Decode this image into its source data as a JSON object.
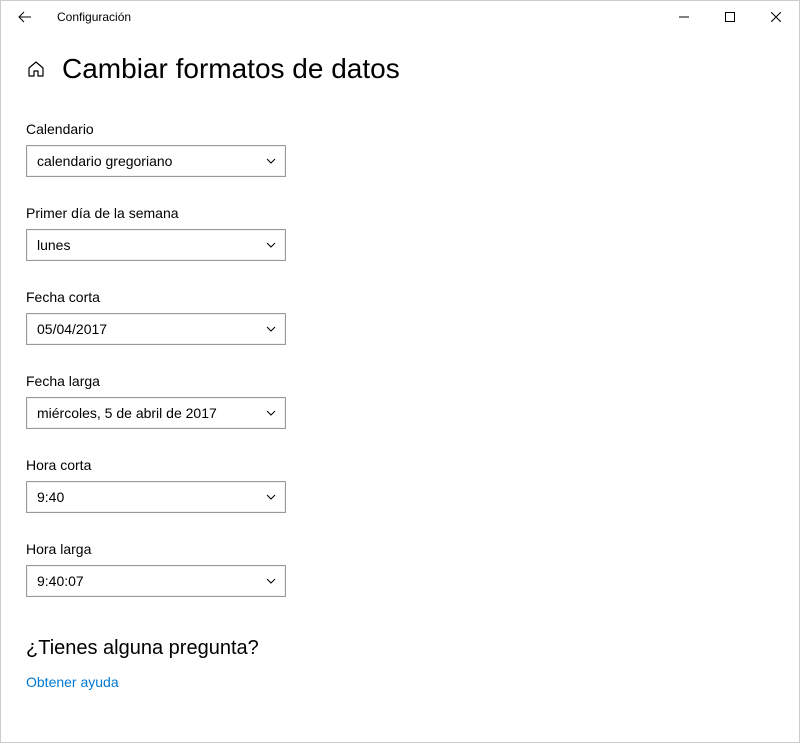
{
  "titlebar": {
    "title": "Configuración"
  },
  "page": {
    "title": "Cambiar formatos de datos"
  },
  "fields": {
    "calendar": {
      "label": "Calendario",
      "value": "calendario gregoriano"
    },
    "firstDay": {
      "label": "Primer día de la semana",
      "value": "lunes"
    },
    "shortDate": {
      "label": "Fecha corta",
      "value": "05/04/2017"
    },
    "longDate": {
      "label": "Fecha larga",
      "value": "miércoles, 5 de abril de 2017"
    },
    "shortTime": {
      "label": "Hora corta",
      "value": "9:40"
    },
    "longTime": {
      "label": "Hora larga",
      "value": "9:40:07"
    }
  },
  "help": {
    "heading": "¿Tienes alguna pregunta?",
    "link": "Obtener ayuda"
  }
}
